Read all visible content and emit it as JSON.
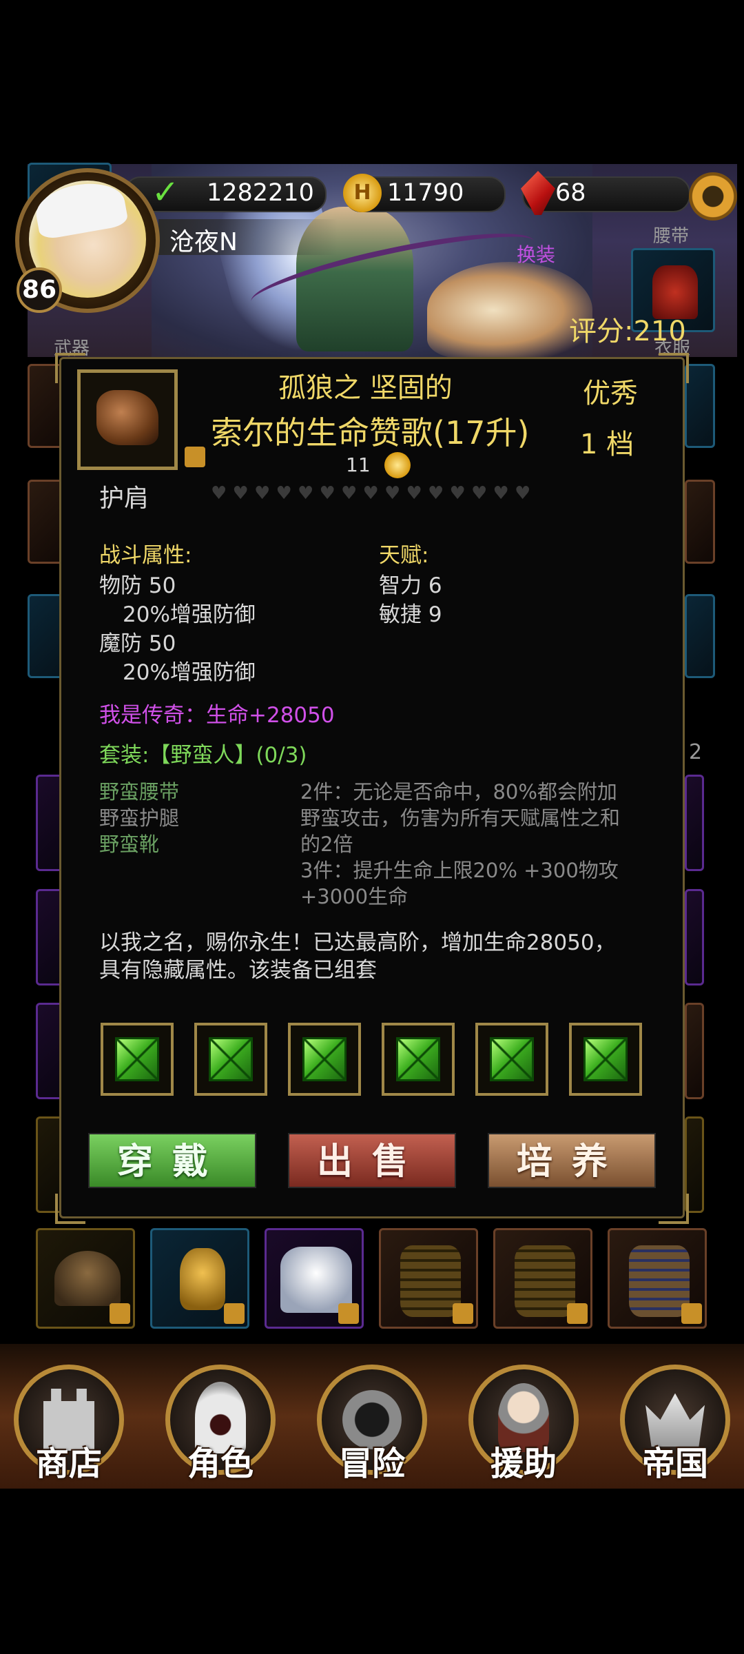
{
  "hud": {
    "exp": "1282210",
    "gold": "11790",
    "gems": "68",
    "player_name": "沧夜N",
    "level": "86",
    "switch_outfit": "换装",
    "score": "评分:210"
  },
  "slot_labels": {
    "belt": "腰带",
    "weapon": "武器",
    "clothes": "衣服",
    "partial_right_count": "2"
  },
  "item": {
    "prefix": "孤狼之  坚固的",
    "name": "索尔的生命赞歌(17升)",
    "level_req": "11",
    "type": "护肩",
    "quality": "优秀",
    "tier": "1  档",
    "combat_header": "战斗属性:",
    "combat_stats": [
      "物防 50",
      "20%增强防御",
      "魔防 50",
      "20%增强防御"
    ],
    "talent_header": "天赋:",
    "talent_stats": [
      "智力 6",
      "敏捷 9"
    ],
    "legend_bonus": "我是传奇：生命+28050",
    "set_title": "套装:【野蛮人】(0/3)",
    "set_pieces": [
      "野蛮腰带",
      "野蛮护腿",
      "野蛮靴"
    ],
    "set_bonus": [
      "2件：无论是否命中，80%都会附加",
      "野蛮攻击，伤害为所有天赋属性之和",
      "的2倍",
      "3件：提升生命上限20% +300物攻",
      "+3000生命"
    ],
    "description": [
      "以我之名，赐你永生！已达最高阶，增加生命28050，",
      "具有隐藏属性。该装备已组套"
    ],
    "sockets": 6,
    "hearts": 15
  },
  "buttons": {
    "wear": "穿戴",
    "sell": "出售",
    "train": "培养"
  },
  "nav": [
    "商店",
    "角色",
    "冒险",
    "援助",
    "帝国"
  ],
  "colors": {
    "accent_gold": "#f0d868",
    "legend_purple": "#d050e8",
    "set_green": "#7ed85a"
  }
}
